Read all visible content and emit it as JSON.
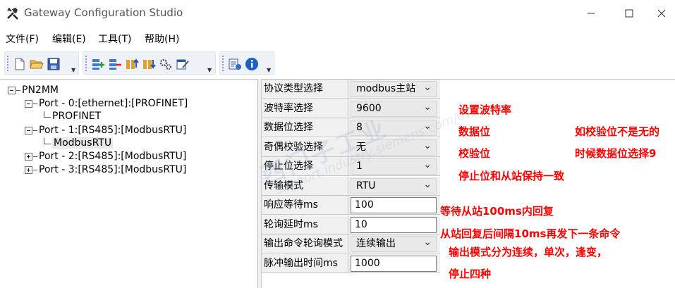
{
  "window": {
    "title": "Gateway Configuration Studio",
    "icon": "tools-icon"
  },
  "menu": {
    "file": "文件(F)",
    "edit": "编辑(E)",
    "tools": "工具(T)",
    "help": "帮助(H)"
  },
  "toolbar": {
    "groups": [
      [
        "new-icon",
        "open-icon",
        "save-icon"
      ],
      [
        "add-port-icon",
        "remove-port-icon",
        "upload-icon",
        "download-icon",
        "settings-icon",
        "edit-icon"
      ],
      [
        "properties-icon",
        "info-icon"
      ]
    ]
  },
  "tree": {
    "root": "PN2MM",
    "port0": "Port - 0:[ethernet]:[PROFINET]",
    "port0_child": "PROFINET",
    "port1": "Port - 1:[RS485]:[ModbusRTU]",
    "port1_child": "ModbusRTU",
    "port2": "Port - 2:[RS485]:[ModbusRTU]",
    "port3": "Port - 3:[RS485]:[ModbusRTU]"
  },
  "properties": [
    {
      "label": "协议类型选择",
      "value": "modbus主站",
      "kind": "combo"
    },
    {
      "label": "波特率选择",
      "value": "9600",
      "kind": "combo"
    },
    {
      "label": "数据位选择",
      "value": "8",
      "kind": "combo"
    },
    {
      "label": "奇偶校验选择",
      "value": "无",
      "kind": "combo"
    },
    {
      "label": "停止位选择",
      "value": "1",
      "kind": "combo"
    },
    {
      "label": "传输模式",
      "value": "RTU",
      "kind": "combo"
    },
    {
      "label": "响应等待ms",
      "value": "100",
      "kind": "text"
    },
    {
      "label": "轮询延时ms",
      "value": "10",
      "kind": "text"
    },
    {
      "label": "输出命令轮询模式",
      "value": "连续输出",
      "kind": "combo"
    },
    {
      "label": "脉冲输出时间ms",
      "value": "1000",
      "kind": "text"
    }
  ],
  "annotations": {
    "baud": "设置波特率",
    "databits": "数据位",
    "databits_note1": "如校验位不是无的",
    "parity": "校验位",
    "databits_note2": "时候数据位选择9",
    "stopbits": "停止位和从站保持一致",
    "response": "等待从站100ms内回复",
    "polling": "从站回复后间隔10ms再发下一条命令",
    "output_mode1": "输出模式分为连续，单次，逢变，",
    "output_mode2": "停止四种"
  },
  "watermark": {
    "line1": "西门子工业",
    "line2": "support.industry.siemens.com/cs"
  },
  "colors": {
    "annotation": "#ff0000",
    "grid_bg": "#f0f0f0"
  }
}
